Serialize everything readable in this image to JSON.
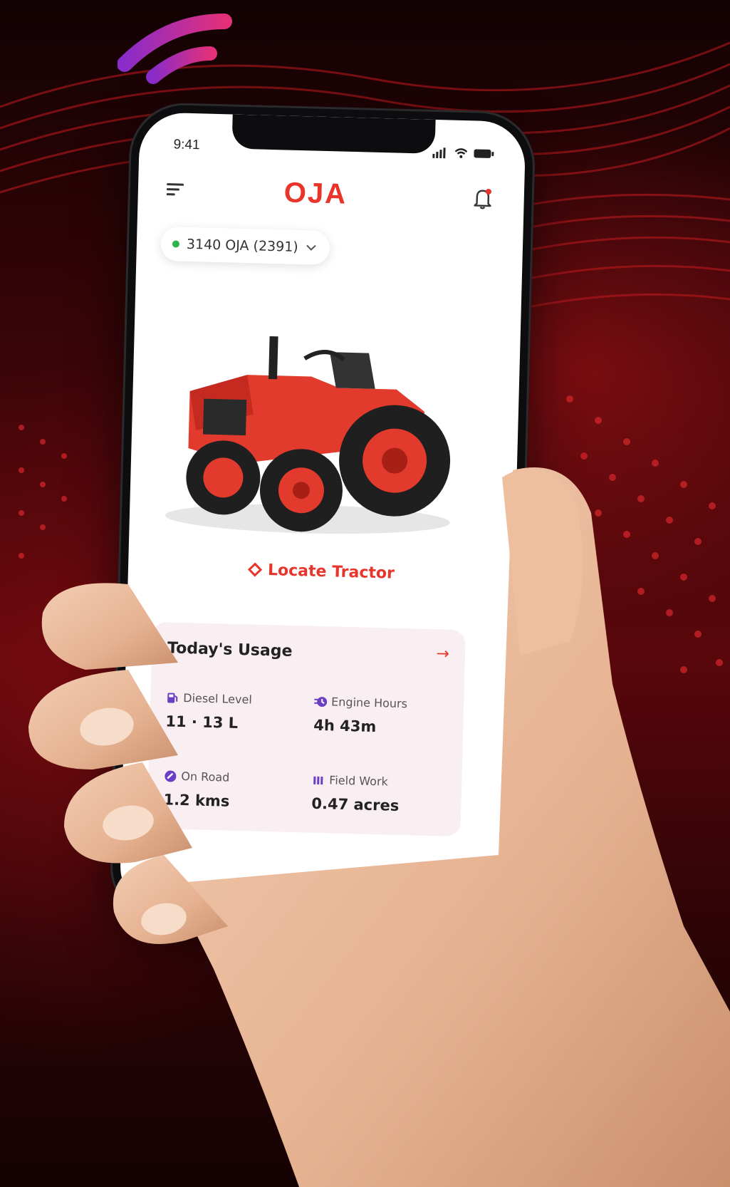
{
  "status_bar": {
    "time": "9:41"
  },
  "header": {
    "logo": "OJA"
  },
  "vehicle": {
    "label": "3140 OJA (2391)",
    "status_color": "#2cb34a"
  },
  "actions": {
    "locate_label": "Locate Tractor"
  },
  "usage": {
    "title": "Today's Usage",
    "metrics": [
      {
        "label": "Diesel Level",
        "value": "11 · 13 L",
        "icon": "fuel-icon"
      },
      {
        "label": "Engine Hours",
        "value": "4h 43m",
        "icon": "engine-clock-icon"
      },
      {
        "label": "On Road",
        "value": "1.2 kms",
        "icon": "road-icon"
      },
      {
        "label": "Field Work",
        "value": "0.47 acres",
        "icon": "field-icon"
      }
    ]
  },
  "colors": {
    "brand": "#e7352b",
    "accent_purple": "#6b3fc4",
    "card_bg": "#f9eef2"
  }
}
